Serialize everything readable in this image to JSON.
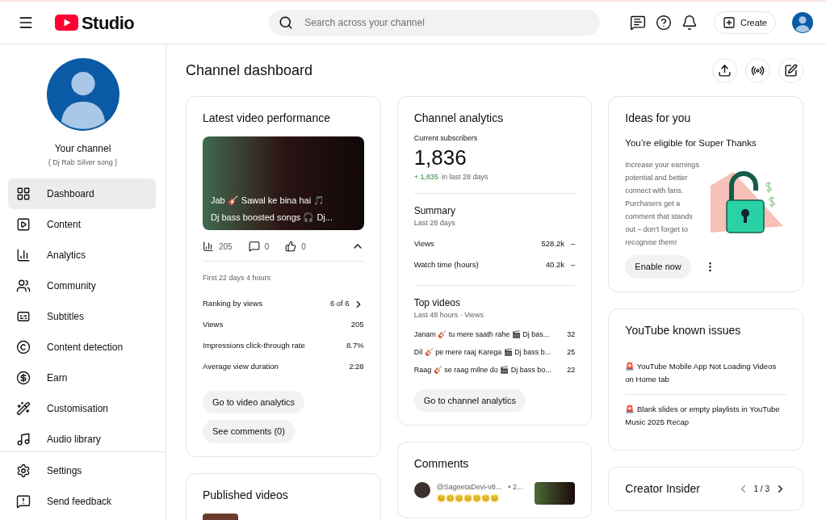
{
  "header": {
    "logo_text": "Studio",
    "search": {
      "placeholder": "Search across your channel"
    },
    "create_label": "Create"
  },
  "sidebar": {
    "channel_title": "Your channel",
    "channel_name": "{ Dj Rab Silver song }",
    "items": [
      {
        "label": "Dashboard",
        "selected": true
      },
      {
        "label": "Content",
        "selected": false
      },
      {
        "label": "Analytics",
        "selected": false
      },
      {
        "label": "Community",
        "selected": false
      },
      {
        "label": "Subtitles",
        "selected": false
      },
      {
        "label": "Content detection",
        "selected": false
      },
      {
        "label": "Earn",
        "selected": false
      },
      {
        "label": "Customisation",
        "selected": false
      },
      {
        "label": "Audio library",
        "selected": false
      }
    ],
    "footer_items": [
      {
        "label": "Settings"
      },
      {
        "label": "Send feedback"
      }
    ]
  },
  "page_title": "Channel dashboard",
  "latest_video": {
    "title": "Latest video performance",
    "thumb_lines": [
      "Jab 🎸 Sawal ke bina hai 🎵",
      "Dj bass boosted songs 🎧 Dj..."
    ],
    "stats": [
      {
        "value": "205"
      },
      {
        "value": "0"
      },
      {
        "value": "0"
      }
    ],
    "period": "First 22 days 4 hours",
    "rows": [
      {
        "label": "Ranking by views",
        "value": "6 of 6",
        "link": true
      },
      {
        "label": "Views",
        "value": "205",
        "link": false
      },
      {
        "label": "Impressions click-through rate",
        "value": "8.7%",
        "link": false
      },
      {
        "label": "Average view duration",
        "value": "2:28",
        "link": false
      }
    ],
    "buttons": [
      "Go to video analytics",
      "See comments (0)"
    ]
  },
  "published": {
    "title": "Published videos"
  },
  "analytics": {
    "title": "Channel analytics",
    "subs_label": "Current subscribers",
    "subs": "1,836",
    "subs_change": "+ 1,835",
    "subs_period": "in last 28 days",
    "summary_title": "Summary",
    "summary_period": "Last 28 days",
    "summary_rows": [
      {
        "label": "Views",
        "value": "528.2k",
        "trend": "–"
      },
      {
        "label": "Watch time (hours)",
        "value": "40.2k",
        "trend": "–"
      }
    ],
    "top_title": "Top videos",
    "top_period": "Last 48 hours · Views",
    "top_rows": [
      {
        "title": "Janam 🎸 tu mere saath rahe 🎬 Dj bas...",
        "views": "32"
      },
      {
        "title": "Dil 🎸 pe mere raaj Karega 🎬 Dj bass b...",
        "views": "25"
      },
      {
        "title": "Raag 🎸 se raag milne do 🎬 Dj bass bo...",
        "views": "22"
      }
    ],
    "button": "Go to channel analytics"
  },
  "comments": {
    "title": "Comments",
    "author": "@SageetaDevi-v8...",
    "time": "• 2...",
    "text": "😊😊😊😊😊😊😊"
  },
  "ideas": {
    "title": "Ideas for you",
    "heading": "You’re eligible for Super Thanks",
    "body": "Increase your earnings potential and better connect with fans. Purchasers get a comment that stands out – don’t forget to recognise them!",
    "button": "Enable now"
  },
  "issues": {
    "title": "YouTube known issues",
    "items": [
      "🚨 YouTube Mobile App Not Loading Videos on Home tab",
      "🚨 Blank slides or empty playlists in YouTube Music 2025 Recap"
    ]
  },
  "insider": {
    "title": "Creator Insider",
    "pager": "1 / 3"
  }
}
